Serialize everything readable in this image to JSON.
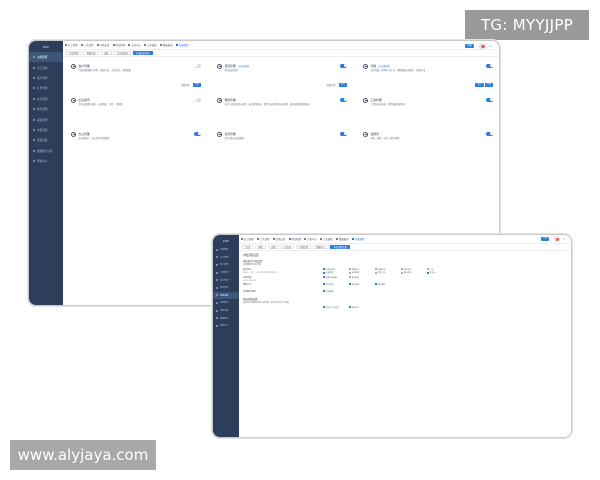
{
  "watermarks": {
    "top_right": "TG: MYYJJPP",
    "bottom_left": "www.alyjaya.com"
  },
  "colors": {
    "sidebar": "#2c3e5c",
    "accent": "#2b7de0",
    "toggle_off": "#dcdfe6"
  },
  "window1": {
    "sidebar": {
      "logo": "ERP",
      "items": [
        "功能配置",
        "员工管理",
        "客户管理",
        "订单管理",
        "库存管理",
        "财务管理",
        "采购管理",
        "审批流程",
        "系统设置",
        "数据统计分析",
        "帮助中心"
      ],
      "active_index": 0
    },
    "topbar": {
      "nav": [
        "员工管理",
        "工作流程",
        "日程安排",
        "项目管理",
        "文档中心",
        "公告通知",
        "数据报表",
        "系统配置"
      ],
      "active_nav": 7,
      "button": "升级"
    },
    "tabs": [
      "全部功能",
      "基础功能",
      "高级",
      "已开通功能",
      "扩展应用市场"
    ],
    "active_tab": 4,
    "cards": [
      {
        "title": "客户管理",
        "sub": "",
        "desc": "可视化管理客户资料、跟进记录、合同信息、销售数据",
        "on": false,
        "link": "查看详情",
        "button": "开通"
      },
      {
        "title": "项目管理",
        "sub": "已开通功能",
        "desc": "项目进度管理",
        "on": true,
        "link": "查看详情",
        "button": "设置"
      },
      {
        "title": "考勤",
        "sub": "已开通功能",
        "desc": "灵活排班、多种打卡方式、考勤数据自动统计、报表导出",
        "on": true,
        "link": "",
        "button": "设置",
        "button2": "开通"
      },
      {
        "title": "企业通讯",
        "sub": "",
        "desc": "企业内部即时通讯，支持群组、文件、音视频",
        "on": false,
        "link": "",
        "button": ""
      },
      {
        "title": "审批管理",
        "sub": "",
        "desc": "自定义审批流程与表单，支持多级审批、条件分支和审批记录追溯，移动端随时随地审批",
        "on": true,
        "link": "",
        "button": ""
      },
      {
        "title": "工资管理",
        "sub": "",
        "desc": "工资条自动发放，薪资数据加密保护",
        "on": true,
        "link": "",
        "button": ""
      },
      {
        "title": "办公管理",
        "sub": "",
        "desc": "会议室预订、办公用品申领管理",
        "on": true,
        "link": "",
        "button": ""
      },
      {
        "title": "任务管理",
        "sub": "",
        "desc": "任务分配与进度跟踪",
        "on": true,
        "link": "",
        "button": ""
      },
      {
        "title": "进销存",
        "sub": "",
        "desc": "采购、销售、库存一体化管理",
        "on": true,
        "link": "",
        "button": ""
      }
    ]
  },
  "window2": {
    "sidebar": {
      "logo": "ERP",
      "items": [
        "功能配置",
        "员工管理",
        "客户管理",
        "订单管理",
        "库存管理",
        "财务管理",
        "审批流程",
        "采购管理",
        "系统设置",
        "数据统计",
        "帮助中心"
      ],
      "active_index": 6
    },
    "topbar": {
      "nav": [
        "员工管理",
        "工作流程",
        "日程安排",
        "项目管理",
        "文档中心",
        "公告通知",
        "数据报表",
        "系统配置"
      ],
      "active_nav": 7,
      "button": "升级"
    },
    "tabs": [
      "全部",
      "基础",
      "高级",
      "已开通",
      "扩展应用",
      "模板中心",
      "审批流程设置"
    ],
    "active_tab": 6,
    "settings": {
      "title": "审批流程设置",
      "section1": "审批表单字段设置",
      "note": "选择需要显示的字段",
      "rows": [
        {
          "label": "基本信息",
          "hint": "申请人、部门、申请时间等基础信息字段",
          "options": [
            {
              "text": "申请人姓名",
              "on": true
            },
            {
              "text": "所属部门",
              "on": false
            },
            {
              "text": "申请日期",
              "on": false
            },
            {
              "text": "联系电话",
              "on": false
            },
            {
              "text": "工号",
              "on": false
            },
            {
              "text": "申请类型",
              "on": true
            },
            {
              "text": "紧急程度",
              "on": false
            },
            {
              "text": "附件上传",
              "on": false
            },
            {
              "text": "备注说明",
              "on": false
            },
            {
              "text": "抄送人",
              "on": true
            }
          ]
        },
        {
          "label": "审批设置",
          "hint": "审批人设置规则",
          "options": [
            {
              "text": "直属上级审批",
              "on": true
            },
            {
              "text": "指定成员",
              "on": false
            }
          ]
        },
        {
          "label": "通知方式",
          "hint": "",
          "options": [
            {
              "text": "站内消息",
              "on": true
            },
            {
              "text": "邮件通知",
              "on": true
            },
            {
              "text": "短信通知",
              "on": true
            }
          ]
        },
        {
          "label": "审批超时提醒",
          "hint": "",
          "options": [
            {
              "text": "开启提醒",
              "on": true
            }
          ]
        }
      ],
      "section2": "审批权限设置",
      "note2": "选择可以发起审批的人员范围，默认全体员工可发起",
      "rows2": [
        {
          "label": "",
          "hint": "",
          "options": [
            {
              "text": "全体员工可发起",
              "on": true
            },
            {
              "text": "指定部门",
              "on": true
            }
          ]
        }
      ]
    }
  }
}
